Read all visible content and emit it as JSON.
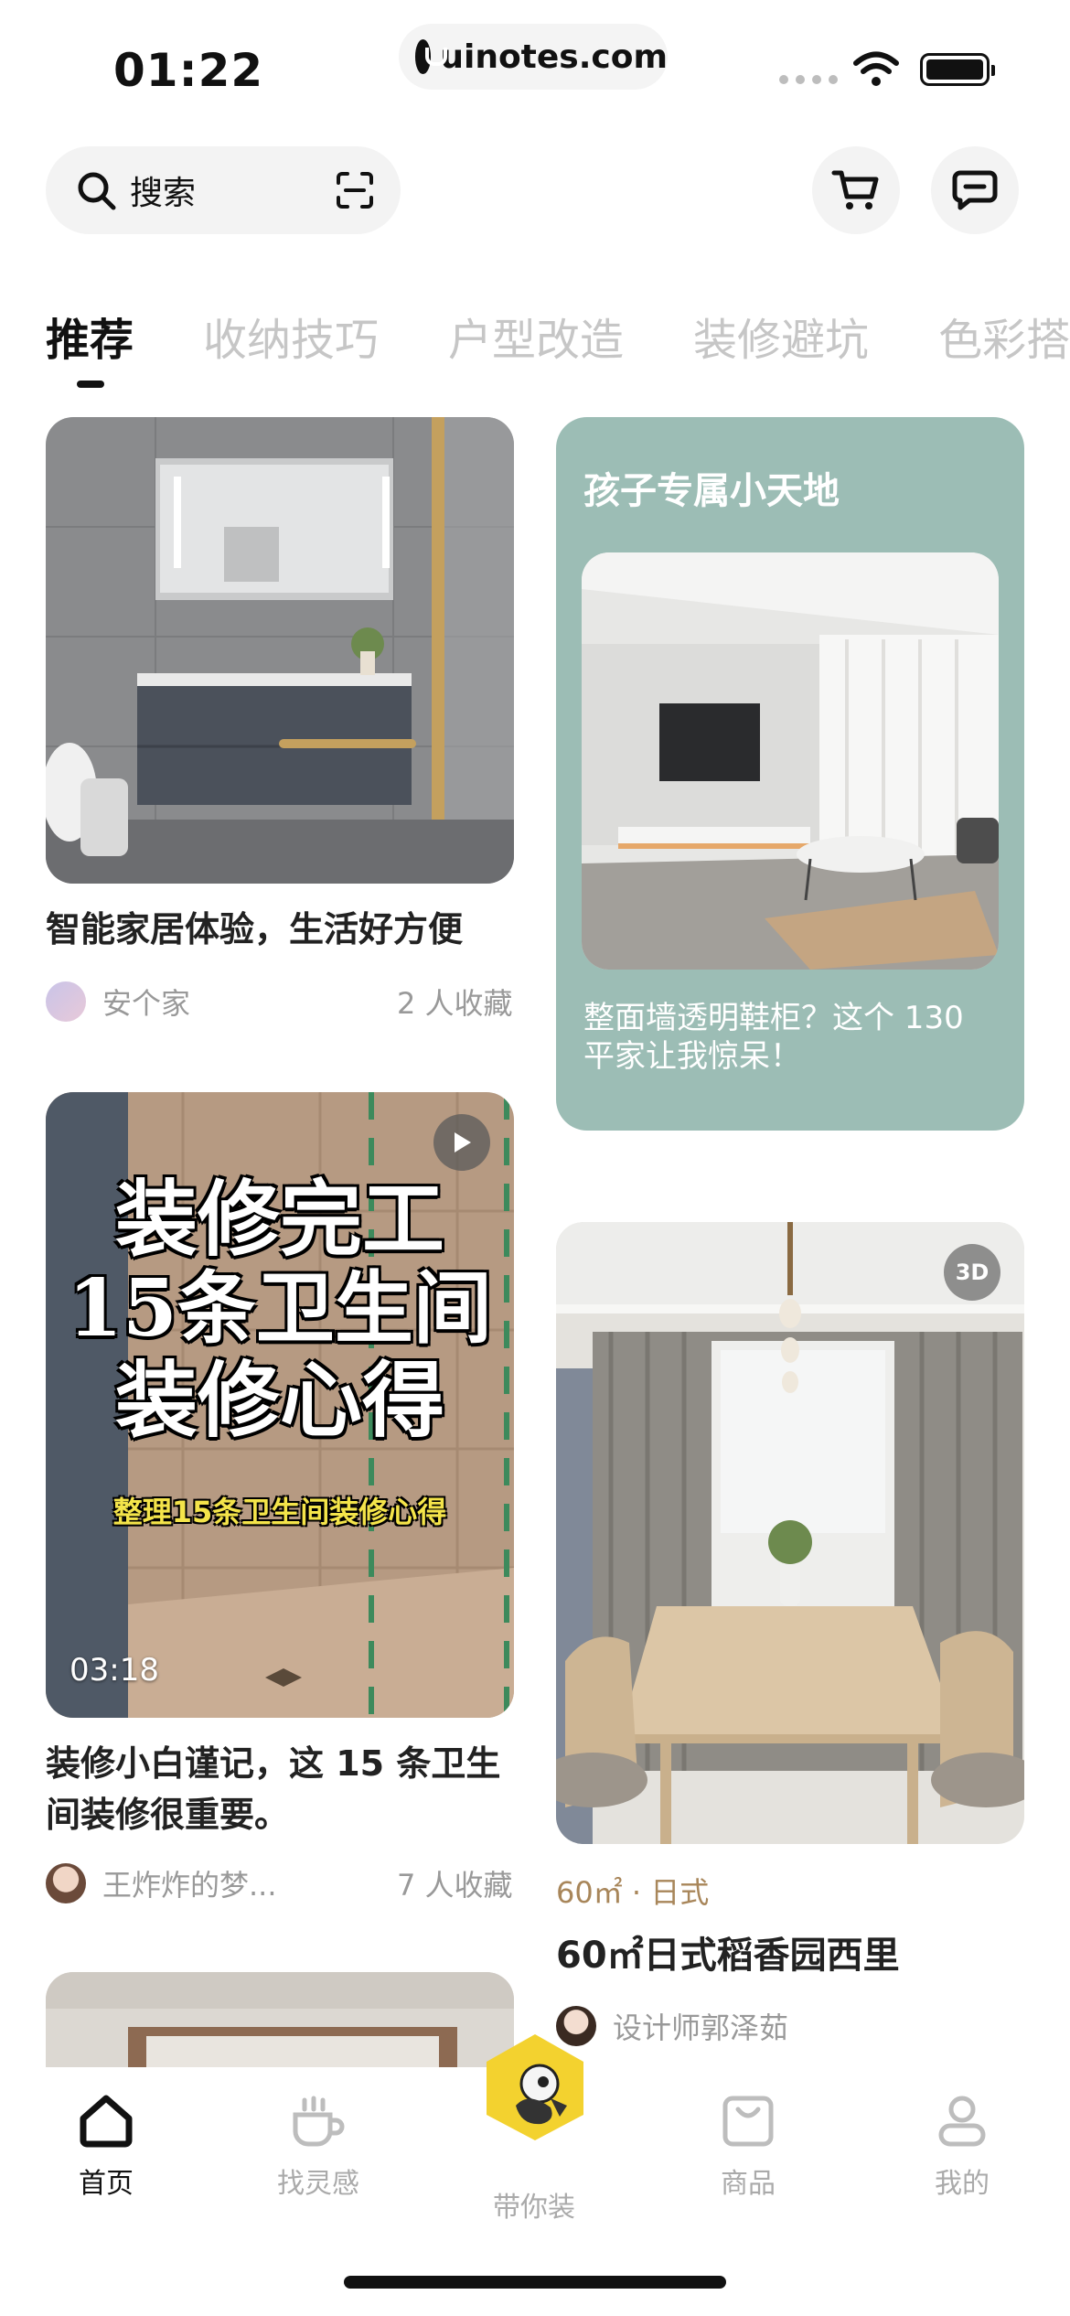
{
  "status_bar": {
    "time": "01:22",
    "url": "uinotes.com"
  },
  "search": {
    "placeholder": "搜索"
  },
  "tabs": [
    {
      "label": "推荐",
      "active": true
    },
    {
      "label": "收纳技巧",
      "active": false
    },
    {
      "label": "户型改造",
      "active": false
    },
    {
      "label": "装修避坑",
      "active": false
    },
    {
      "label": "色彩搭",
      "active": false
    }
  ],
  "feed": {
    "card1": {
      "title": "智能家居体验，生活好方便",
      "author": "安个家",
      "collects": "2 人收藏"
    },
    "card2": {
      "heading": "孩子专属小天地",
      "desc": "整面墙透明鞋柜？这个 130 平家让我惊呆！"
    },
    "card3": {
      "overlay_line1": "装修完工",
      "overlay_line2": "15条卫生间",
      "overlay_line3": "装修心得",
      "overlay_sub": "整理15条卫生间装修心得",
      "duration": "03:18",
      "title": "装修小白谨记，这 15 条卫生间装修很重要。",
      "author": "王炸炸的梦...",
      "collects": "7 人收藏"
    },
    "card4": {
      "badge": "3D",
      "tag": "60㎡ · 日式",
      "title": "60㎡日式稻香园西里",
      "author": "设计师郭泽茹"
    }
  },
  "bottom_nav": [
    {
      "label": "首页",
      "icon": "home-icon",
      "active": true
    },
    {
      "label": "找灵感",
      "icon": "coffee-cup-icon",
      "active": false
    },
    {
      "label": "带你装",
      "icon": "mascot-icon",
      "active": false
    },
    {
      "label": "商品",
      "icon": "shopping-bag-icon",
      "active": false
    },
    {
      "label": "我的",
      "icon": "profile-icon",
      "active": false
    }
  ],
  "colors": {
    "accent": "#f3d22f",
    "featured_card": "#9cbdb5",
    "tag_gold": "#a8865a"
  }
}
